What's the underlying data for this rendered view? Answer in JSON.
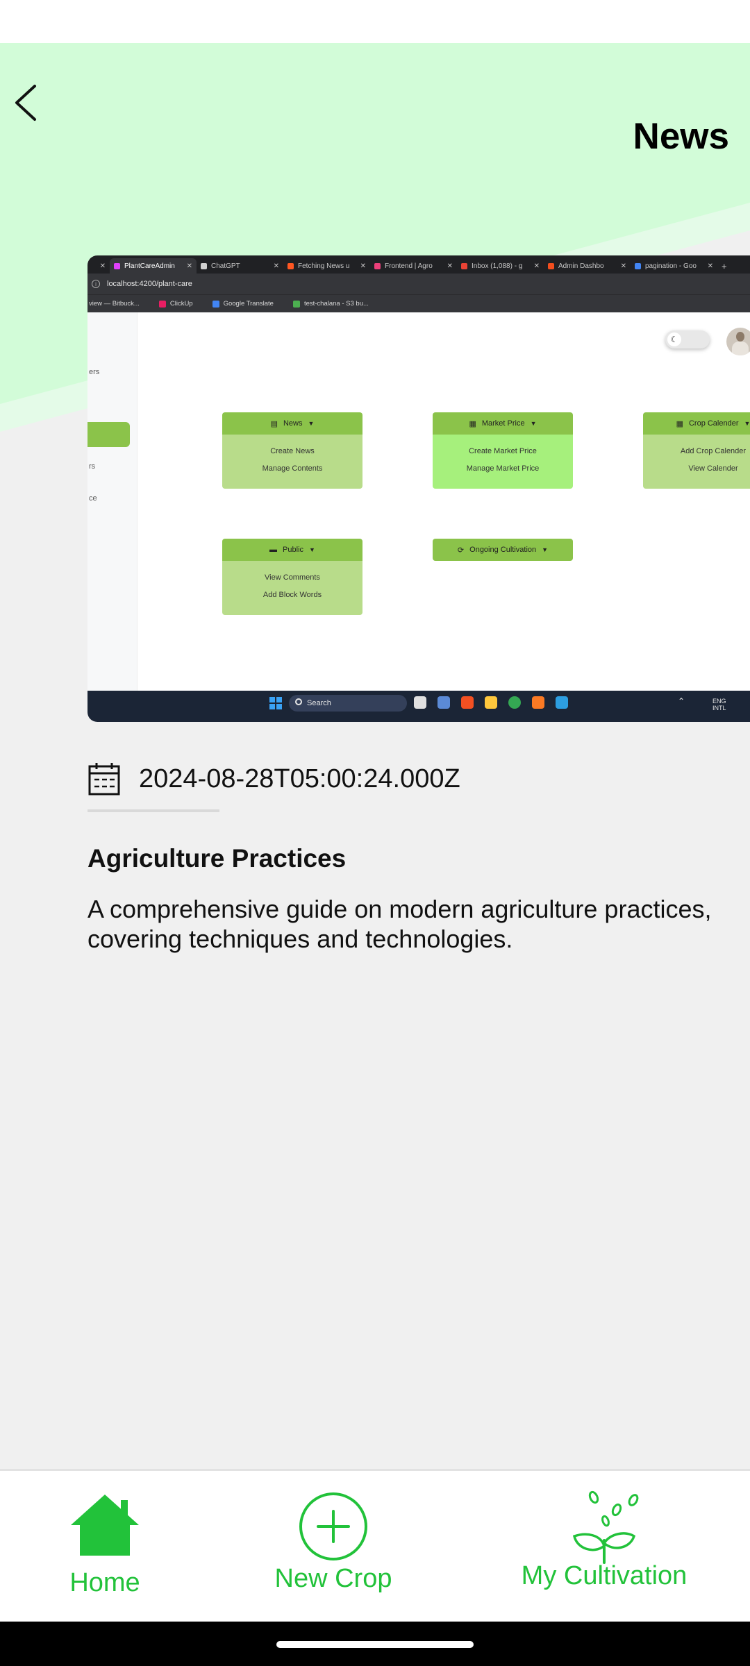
{
  "header": {
    "title": "News",
    "back_icon": "chevron-left-icon",
    "accent_color": "#d2fcd8"
  },
  "news_image": {
    "browser_tabs": [
      {
        "label": "PlantCareAdmin",
        "color": "#e040fb",
        "active": true
      },
      {
        "label": "ChatGPT",
        "color": "#d0d0d0",
        "active": false
      },
      {
        "label": "Fetching News u",
        "color": "#ff5722",
        "active": false
      },
      {
        "label": "Frontend | Agro",
        "color": "#ec407a",
        "active": false
      },
      {
        "label": "Inbox (1,088) - g",
        "color": "#ea4335",
        "active": false
      },
      {
        "label": "Admin Dashbo",
        "color": "#f24e1e",
        "active": false
      },
      {
        "label": "pagination - Goo",
        "color": "#4285f4",
        "active": false
      }
    ],
    "tab_close": "✕",
    "new_tab": "+",
    "url": "localhost:4200/plant-care",
    "bookmarks": [
      {
        "label": "view — Bitbuck...",
        "color": ""
      },
      {
        "label": "ClickUp",
        "color": "#e91e63"
      },
      {
        "label": "Google Translate",
        "color": "#4285f4"
      },
      {
        "label": "test-chalana - S3 bu...",
        "color": "#4caf50"
      }
    ],
    "sidebar_items": [
      "ers",
      "rs",
      "ce"
    ],
    "cards": [
      {
        "title": "News",
        "icon": "▤",
        "items": [
          "Create News",
          "Manage Contents"
        ],
        "highlight": false
      },
      {
        "title": "Market Price",
        "icon": "▦",
        "items": [
          "Create Market Price",
          "Manage Market Price"
        ],
        "highlight": true
      },
      {
        "title": "Crop Calender",
        "icon": "▦",
        "items": [
          "Add Crop Calender",
          "View Calender"
        ],
        "highlight": false
      },
      {
        "title": "Public",
        "icon": "▬",
        "items": [
          "View Comments",
          "Add Block Words"
        ],
        "highlight": false
      },
      {
        "title": "Ongoing Cultivation",
        "icon": "⟳",
        "items": [],
        "highlight": false
      }
    ],
    "taskbar": {
      "search_label": "Search",
      "tray_lang_1": "ENG",
      "tray_lang_2": "INTL"
    }
  },
  "article": {
    "date": "2024-08-28T05:00:24.000Z",
    "title": "Agriculture Practices",
    "description": "A comprehensive guide on modern agriculture practices, covering techniques and technologies."
  },
  "bottom_nav": {
    "items": [
      {
        "label": "Home",
        "icon": "home-icon",
        "active": true
      },
      {
        "label": "New Crop",
        "icon": "plus-circle-icon",
        "active": false
      },
      {
        "label": "My Cultivation",
        "icon": "sprout-icon",
        "active": false
      }
    ],
    "color": "#22c23a"
  }
}
